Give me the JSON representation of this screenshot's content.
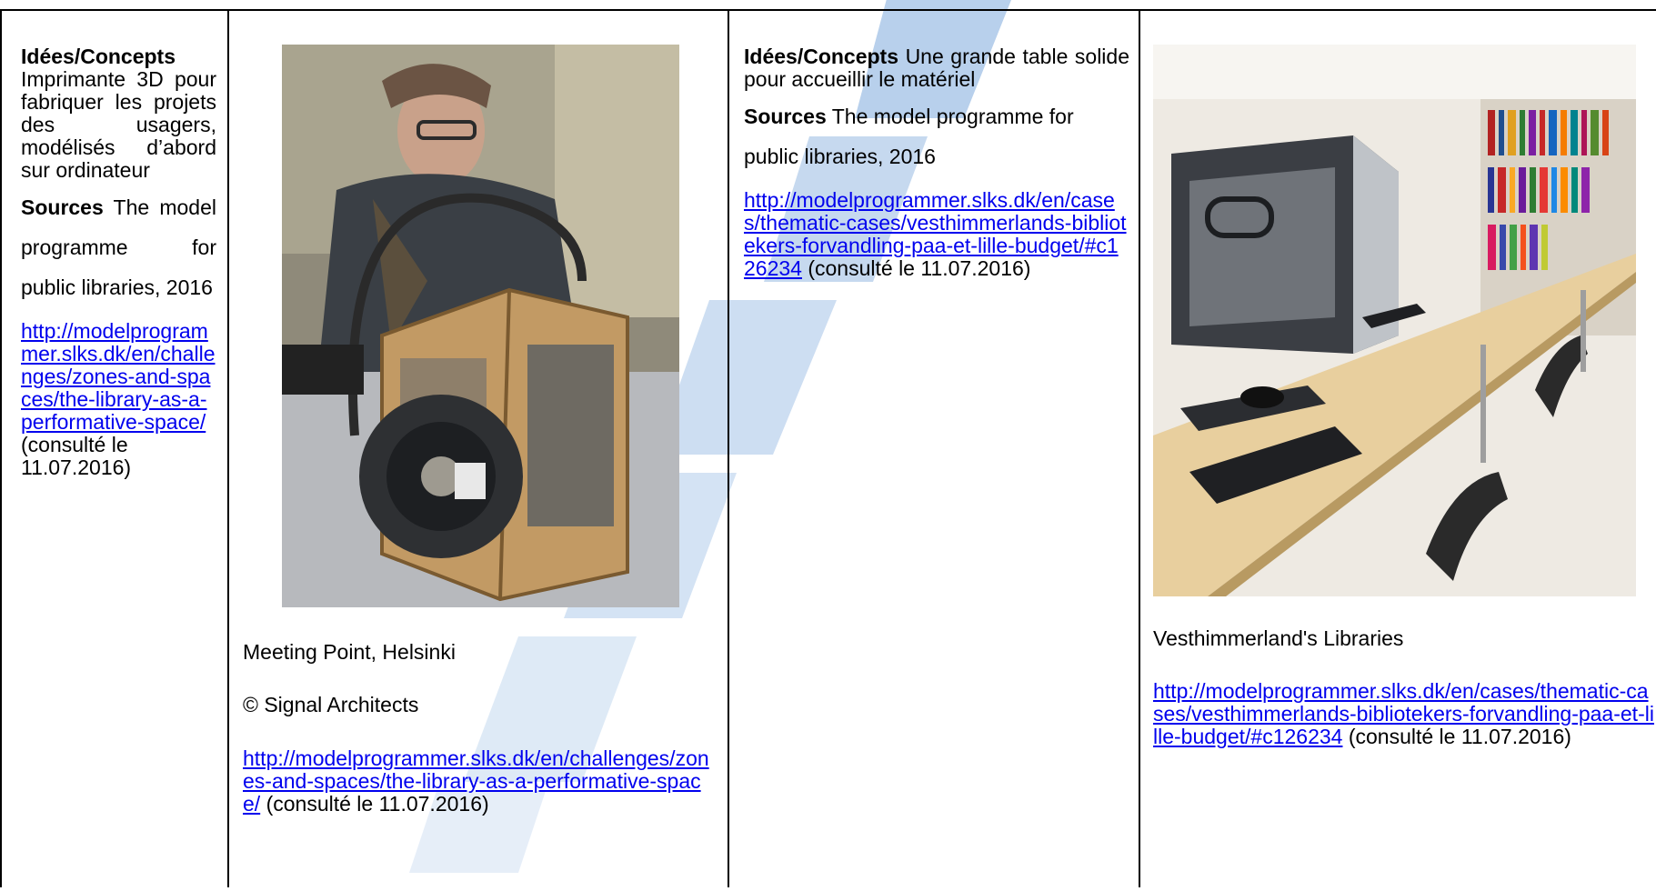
{
  "col1": {
    "heading": "Idées/Concepts",
    "text": "Imprimante 3D pour fabriquer les projets des usagers, modélisés d’abord sur ordinateur",
    "sources_label": "Sources",
    "sources_text": "The model programme for public libraries, 2016",
    "link": "http://modelprogrammer.slks.dk/en/challenges/zones-and-spaces/the-library-as-a-performative-space/",
    "consulted": "(consulté le 11.07.2016)"
  },
  "col2": {
    "photo_label": "3D printer photo",
    "caption": "Meeting Point, Helsinki",
    "credit": "© Signal Architects",
    "link": "http://modelprogrammer.slks.dk/en/challenges/zones-and-spaces/the-library-as-a-performative-space/",
    "consulted": "(consulté le 11.07.2016)"
  },
  "col3": {
    "heading": "Idées/Concepts",
    "text": "Une grande table solide pour accueillir le matériel",
    "sources_label": "Sources",
    "sources_text": "The model programme for public libraries, 2016",
    "link": "http://modelprogrammer.slks.dk/en/cases/thematic-cases/vesthimmerlands-bibliotekers-forvandling-paa-et-lille-budget/#c126234",
    "consulted": "(consulté le 11.07.2016)"
  },
  "col4": {
    "photo_label": "Library table photo",
    "caption": "Vesthimmerland's Libraries",
    "link": "http://modelprogrammer.slks.dk/en/cases/thematic-cases/vesthimmerlands-bibliotekers-forvandling-paa-et-lille-budget/#c126234",
    "consulted": "(consulté le 11.07.2016)"
  },
  "colors": {
    "link": "#0000EE",
    "watermark": "#1565C0"
  }
}
